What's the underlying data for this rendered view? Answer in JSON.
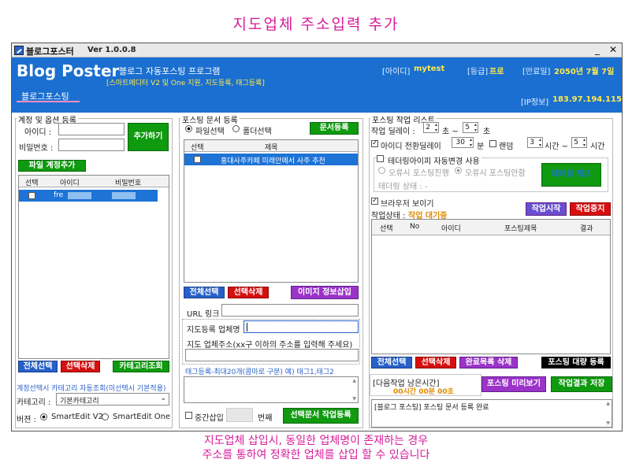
{
  "captions": {
    "top": "지도업체 주소입력 추가",
    "bottom_line1": "지도업체 삽입시, 동일한 업체명이 존재하는 경우",
    "bottom_line2": "주소를 통하여 정확한 업체를 삽입 할 수 있습니다"
  },
  "window": {
    "title": "블로그포스터",
    "version": "Ver 1.0.0.8",
    "minimize": "_",
    "close": "✕"
  },
  "header": {
    "logo": "Blog Poster",
    "subtitle": "블로그 자동포스팅 프로그램",
    "note": "[스마트에디터 V2 및 One 지원, 지도등록, 태그등록]",
    "id_label": "[아이디]",
    "id_value": "mytest",
    "grade_label": "[등급]",
    "grade_value": "프로",
    "expire_label": "[만료일]",
    "expire_value": "2050년 7월 7일",
    "ip_label": "[IP정보]",
    "ip_value": "183.97.194.115",
    "tab": "블로그포스팅"
  },
  "account": {
    "group_title": "계정 및 옵션 등록",
    "id_label": "아이디 :",
    "pw_label": "비밀번호 :",
    "add_button": "추가하기",
    "file_add_button": "파일 계정추가",
    "columns": [
      "선택",
      "아이디",
      "비밀번호"
    ],
    "rows": [
      {
        "id": "fre"
      }
    ],
    "select_all": "전체선택",
    "delete_selected": "선택삭제",
    "category_lookup": "카테고리조회",
    "category_note": "계정선택시 카테고리 자동조회(미선택시 기본적용)",
    "category_label": "카테고리 :",
    "category_value": "기본카테고리",
    "version_label": "버젼 :",
    "version_opt1": "SmartEdit V2",
    "version_opt2": "SmartEdit One"
  },
  "document": {
    "group_title": "포스팅 문서 등록",
    "opt_file": "파일선택",
    "opt_folder": "폴더선택",
    "register_button": "문서등록",
    "columns": [
      "선택",
      "제목"
    ],
    "rows": [
      {
        "title": "홍대사주카페 미래안에서 사주 추천"
      }
    ],
    "select_all": "전체선택",
    "delete_selected": "선택삭제",
    "image_info": "이미지 정보삽입",
    "url_label": "URL 링크",
    "map_name_label": "지도등록 업체명",
    "map_addr_label": "지도 업체주소(xx구 이하의 주소를 입력해 주세요)",
    "tag_note": "태그등록-최대20개(콤마로 구분) 예) 태그1,태그2",
    "mid_insert_label": "중간삽입",
    "mid_insert_unit": "번째",
    "register_selected": "선택문서 작업등록"
  },
  "jobs": {
    "group_title": "포스팅 작업 리스트",
    "delay_label": "작업 딜레이 :",
    "delay_from": "2",
    "delay_sep": "초 ~",
    "delay_to": "5",
    "delay_unit": "초",
    "id_switch_label": "아이디 전환딜레이",
    "id_switch_value": "30",
    "id_switch_unit": "분",
    "random_label": "랜덤",
    "random_from": "3",
    "random_sep": "시간 ~",
    "random_to": "5",
    "random_unit": "시간",
    "tethering_label": "테더링아이피 자동변경 사용",
    "tether_opt1": "오류시 포스팅진행",
    "tether_opt2": "오류시 포스팅안함",
    "tether_state": "테더링 상태 : -",
    "tether_check": "테더링 체크",
    "browser_label": "브라우저 보이기",
    "status_label": "작업상태 :",
    "status_value": "작업 대기중",
    "start_button": "작업시작",
    "stop_button": "작업중지",
    "columns": [
      "선택",
      "No",
      "아이디",
      "포스팅제목",
      "결과"
    ],
    "select_all": "전체선택",
    "delete_selected": "선택삭제",
    "delete_done": "완료목록 삭제",
    "bulk_register": "포스팅 대량 등록",
    "next_label": "[다음작업 남은시간]",
    "next_value": "00시간 00분 00초",
    "preview": "포스팅 미리보기",
    "save_result": "작업결과 저장",
    "log_text": "[블로그 포스팅] 포스팅 문서 등록 완료"
  }
}
